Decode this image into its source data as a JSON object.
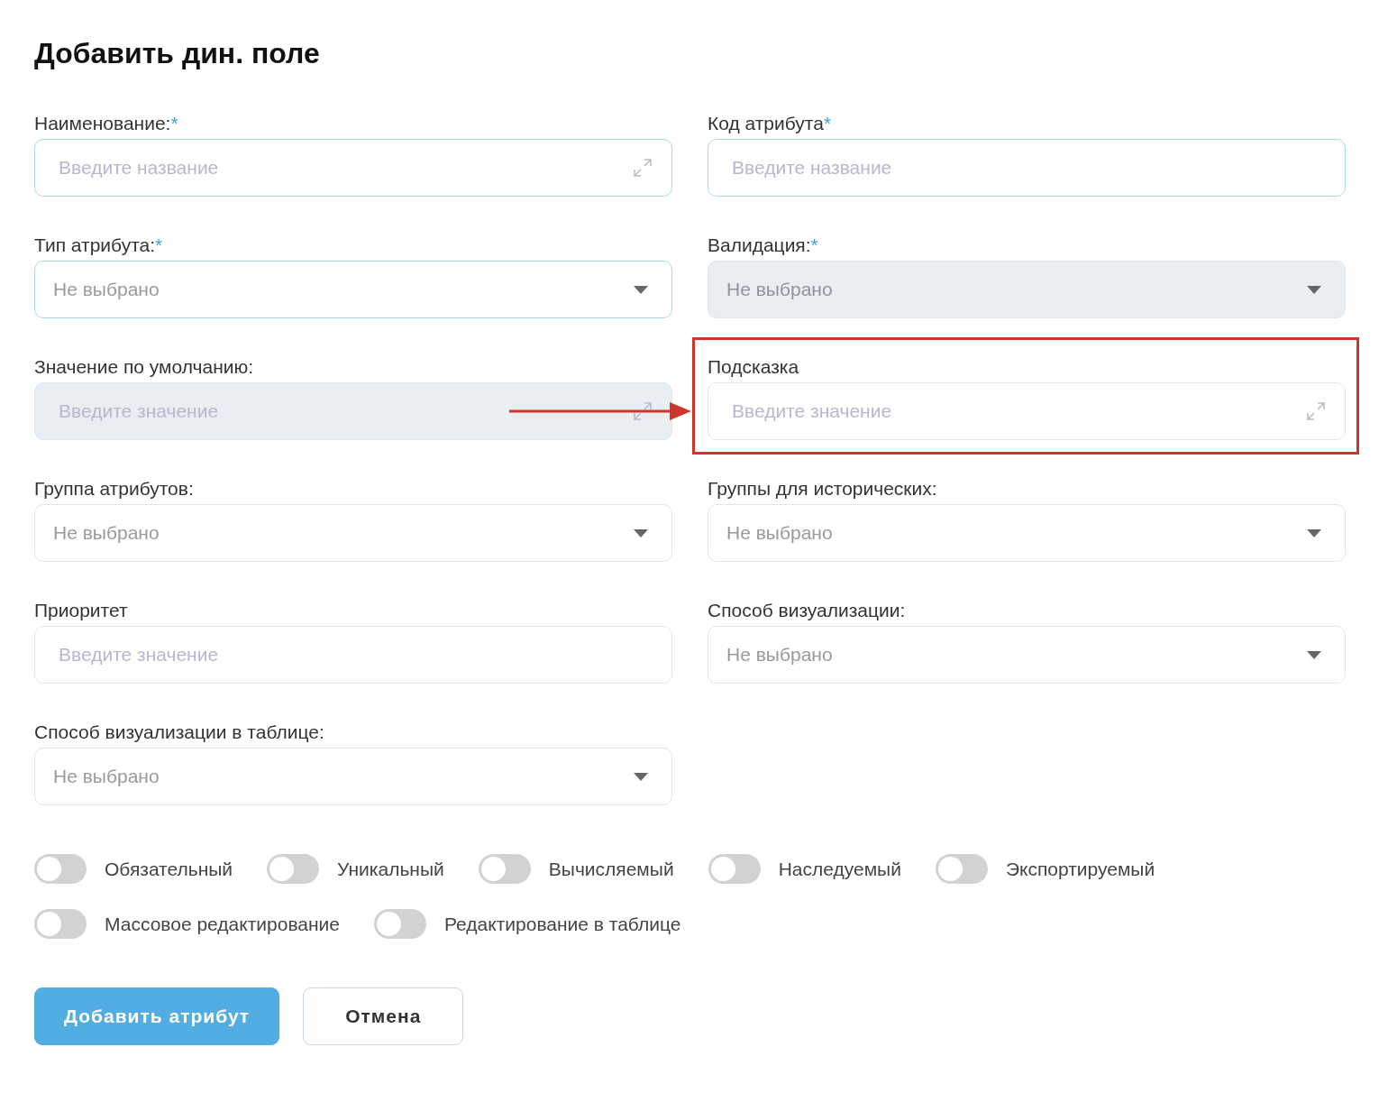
{
  "dialog": {
    "title": "Добавить дин. поле"
  },
  "fields": [
    {
      "kind": "text",
      "label": "Наименование:",
      "required_mark": "*",
      "placeholder": "Введите название",
      "expandable": true,
      "highlighted": true,
      "disabled": false,
      "annotated": false
    },
    {
      "kind": "text",
      "label": "Код атрибута",
      "required_mark": "*",
      "placeholder": "Введите название",
      "expandable": false,
      "highlighted": true,
      "disabled": false,
      "annotated": false
    },
    {
      "kind": "select",
      "label": "Тип атрибута:",
      "required_mark": "*",
      "value": "Не выбрано",
      "highlighted": true,
      "disabled": false,
      "annotated": false
    },
    {
      "kind": "select",
      "label": "Валидация:",
      "required_mark": "*",
      "value": "Не выбрано",
      "highlighted": false,
      "disabled": true,
      "annotated": false
    },
    {
      "kind": "text",
      "label": "Значение по умолчанию:",
      "placeholder": "Введите значение",
      "expandable": true,
      "highlighted": false,
      "disabled": true,
      "annotated": false
    },
    {
      "kind": "text",
      "label": "Подсказка",
      "placeholder": "Введите значение",
      "expandable": true,
      "highlighted": false,
      "disabled": false,
      "annotated": true
    },
    {
      "kind": "select",
      "label": "Группа атрибутов:",
      "value": "Не выбрано",
      "highlighted": false,
      "disabled": false,
      "annotated": false
    },
    {
      "kind": "select",
      "label": "Группы для исторических:",
      "value": "Не выбрано",
      "highlighted": false,
      "disabled": false,
      "annotated": false
    },
    {
      "kind": "text",
      "label": "Приоритет",
      "placeholder": "Введите значение",
      "expandable": false,
      "highlighted": false,
      "disabled": false,
      "annotated": false
    },
    {
      "kind": "select",
      "label": "Способ визуализации:",
      "value": "Не выбрано",
      "highlighted": false,
      "disabled": false,
      "annotated": false
    },
    {
      "kind": "select",
      "label": "Способ визуализации в таблице:",
      "value": "Не выбрано",
      "highlighted": false,
      "disabled": false,
      "annotated": false
    }
  ],
  "toggles": [
    {
      "label": "Обязательный",
      "on": false
    },
    {
      "label": "Уникальный",
      "on": false
    },
    {
      "label": "Вычисляемый",
      "on": false
    },
    {
      "label": "Наследуемый",
      "on": false
    },
    {
      "label": "Экспортируемый",
      "on": false
    },
    {
      "label": "Массовое редактирование",
      "on": false
    },
    {
      "label": "Редактирование в таблице",
      "on": false
    }
  ],
  "buttons": [
    {
      "label": "Добавить атрибут",
      "kind": "primary"
    },
    {
      "label": "Отмена",
      "kind": "secondary"
    }
  ]
}
